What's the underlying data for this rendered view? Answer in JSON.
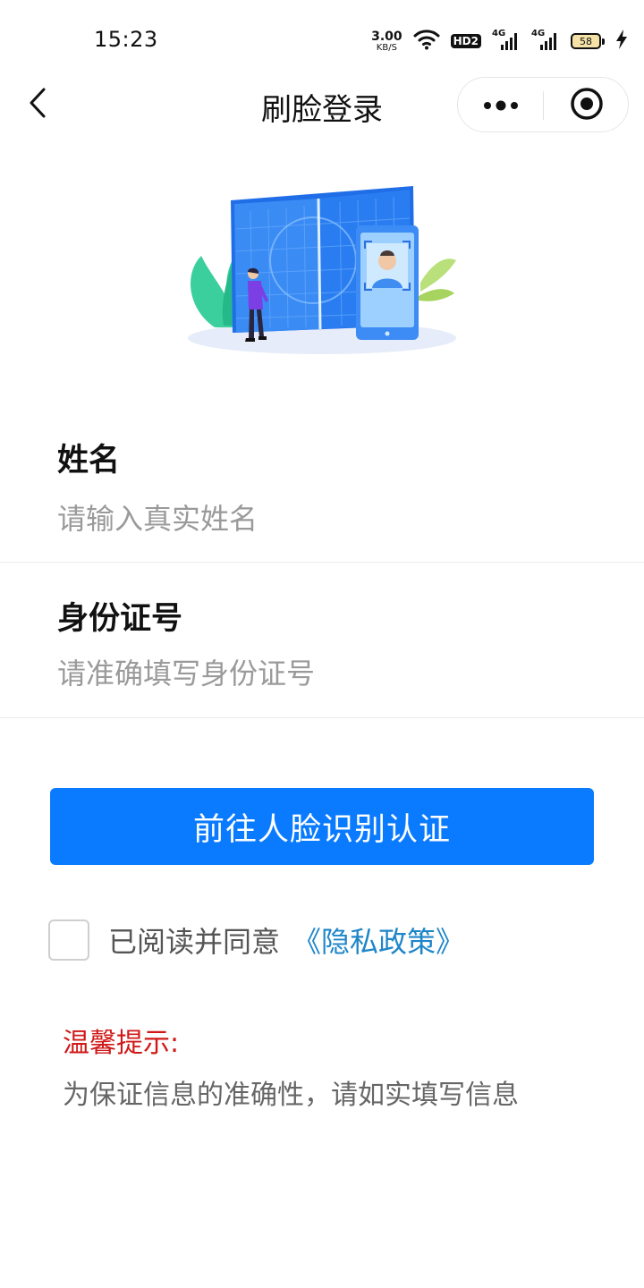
{
  "status_bar": {
    "time": "15:23",
    "net_speed_value": "3.00",
    "net_speed_unit": "KB/S",
    "hd_badge": "HD2",
    "signal_1_label": "4G",
    "signal_2_label": "4G",
    "battery_level": "58",
    "battery_color": "#f4e2a6"
  },
  "nav": {
    "title": "刷脸登录",
    "back_icon": "chevron-left-icon",
    "more_icon": "more-dots-icon",
    "close_icon": "target-circle-icon"
  },
  "form": {
    "name_label": "姓名",
    "name_placeholder": "请输入真实姓名",
    "name_value": "",
    "id_label": "身份证号",
    "id_placeholder": "请准确填写身份证号",
    "id_value": ""
  },
  "submit": {
    "label": "前往人脸识别认证",
    "color": "#0a7bfe"
  },
  "agreement": {
    "checked": false,
    "text": "已阅读并同意",
    "policy_link": "《隐私政策》",
    "link_color": "#1f86c9"
  },
  "tips": {
    "title": "温馨提示:",
    "title_color": "#d01818",
    "text": "为保证信息的准确性，请如实填写信息"
  }
}
